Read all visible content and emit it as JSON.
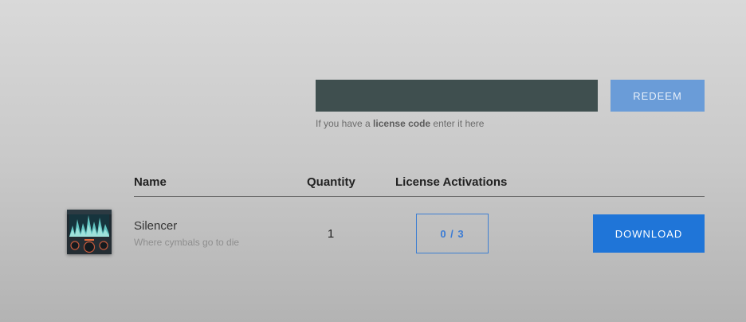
{
  "license": {
    "input_value": "",
    "redeem_label": "REDEEM",
    "hint_prefix": "If you have a ",
    "hint_bold": "license code",
    "hint_suffix": " enter it here"
  },
  "table": {
    "headers": {
      "name": "Name",
      "quantity": "Quantity",
      "license_activations": "License Activations"
    },
    "rows": [
      {
        "thumbnail_icon": "silencer-plugin-thumbnail",
        "name": "Silencer",
        "tagline": "Where cymbals go to die",
        "quantity": "1",
        "activations": "0 / 3",
        "download_label": "DOWNLOAD"
      }
    ]
  },
  "colors": {
    "input_bg": "#3f4f4f",
    "redeem_bg": "#6a9cd8",
    "download_bg": "#1f75d8",
    "activations_border": "#3f7fd1"
  }
}
